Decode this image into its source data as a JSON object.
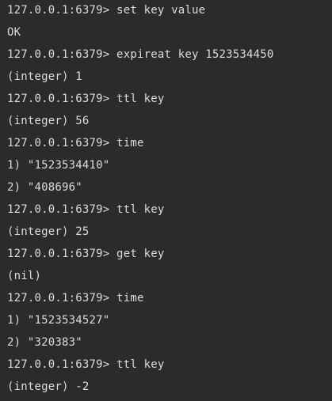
{
  "terminal": {
    "lines": [
      "127.0.0.1:6379> set key value",
      "OK",
      "127.0.0.1:6379> expireat key 1523534450",
      "(integer) 1",
      "127.0.0.1:6379> ttl key",
      "(integer) 56",
      "127.0.0.1:6379> time",
      "1) \"1523534410\"",
      "2) \"408696\"",
      "127.0.0.1:6379> ttl key",
      "(integer) 25",
      "127.0.0.1:6379> get key",
      "(nil)",
      "127.0.0.1:6379> time",
      "1) \"1523534527\"",
      "2) \"320383\"",
      "127.0.0.1:6379> ttl key",
      "(integer) -2"
    ]
  }
}
